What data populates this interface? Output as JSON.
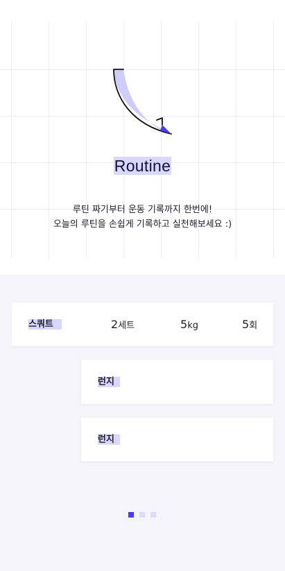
{
  "hero": {
    "title": "Routine",
    "subtitle_line1": "루틴 짜기부터 운동 기록까지 한번에!",
    "subtitle_line2": "오늘의 루틴을 손쉽게 기록하고 실천해보세요 :)"
  },
  "routine": {
    "main": {
      "name": "스쿼트",
      "sets_value": "2",
      "sets_unit": "세트",
      "weight_value": "5",
      "weight_unit": "kg",
      "reps_value": "5",
      "reps_unit": "회"
    },
    "sub_items": [
      {
        "name": "런지"
      },
      {
        "name": "런지"
      }
    ]
  },
  "pagination": {
    "total": 3,
    "active": 1
  },
  "colors": {
    "accent": "#4a3cf0",
    "highlight": "#d9d7fb",
    "background": "#f5f4fa"
  }
}
